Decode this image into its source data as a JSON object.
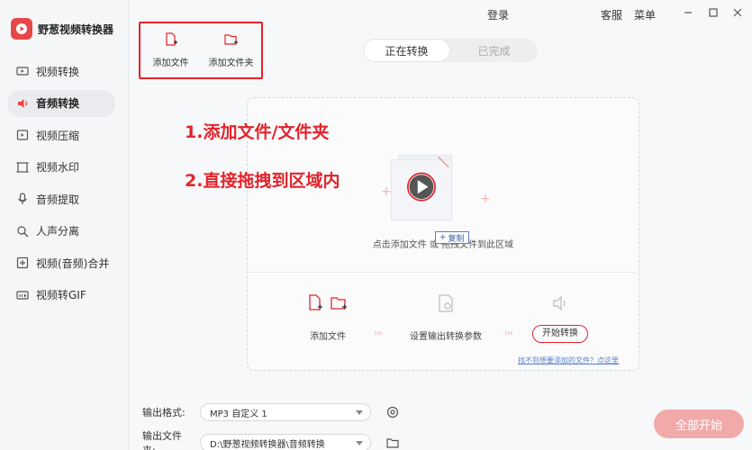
{
  "app": {
    "name": "野葱视频转换器"
  },
  "sidebar": {
    "items": [
      {
        "label": "视频转换",
        "icon": "video-convert-icon",
        "active": false
      },
      {
        "label": "音频转换",
        "icon": "audio-convert-icon",
        "active": true
      },
      {
        "label": "视频压缩",
        "icon": "video-compress-icon",
        "active": false
      },
      {
        "label": "视频水印",
        "icon": "watermark-icon",
        "active": false
      },
      {
        "label": "音频提取",
        "icon": "audio-extract-icon",
        "active": false
      },
      {
        "label": "人声分离",
        "icon": "vocal-separate-icon",
        "active": false
      },
      {
        "label": "视频(音频)合并",
        "icon": "merge-icon",
        "active": false
      },
      {
        "label": "视频转GIF",
        "icon": "gif-icon",
        "active": false
      }
    ]
  },
  "titlebar": {
    "login": "登录",
    "service": "客服",
    "menu": "菜单"
  },
  "toolbar": {
    "add_file": "添加文件",
    "add_folder": "添加文件夹"
  },
  "tabs": [
    {
      "label": "正在转换",
      "active": true
    },
    {
      "label": "已完成",
      "active": false
    }
  ],
  "annotations": {
    "step1": "1.添加文件/文件夹",
    "step2": "2.直接拖拽到区域内"
  },
  "dropzone": {
    "hint": "点击添加文件 或 拖拽文件到此区域",
    "copy_tag": "复制"
  },
  "steps": {
    "add_file": "添加文件",
    "set_params": "设置输出转换参数",
    "start_button": "开始转换"
  },
  "help_link": "找不到想要添加的文件？点这里",
  "output": {
    "format_label": "输出格式:",
    "format_value": "MP3 自定义 1",
    "folder_label": "输出文件夹:",
    "folder_value": "D:\\野葱视频转换器\\音频转换"
  },
  "start_all": "全部开始",
  "colors": {
    "brand": "#e4232b",
    "start_all_bg": "#f2a9a9"
  }
}
